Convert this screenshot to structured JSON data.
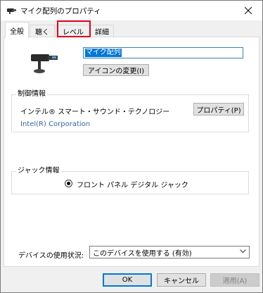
{
  "window": {
    "title": "マイク配列のプロパティ"
  },
  "tabs": [
    {
      "label": "全般",
      "selected": true
    },
    {
      "label": "聴く",
      "selected": false
    },
    {
      "label": "レベル",
      "selected": false,
      "highlighted": true
    },
    {
      "label": "詳細",
      "selected": false
    }
  ],
  "general": {
    "device_name": "マイク配列",
    "change_icon_label": "アイコンの変更(I)",
    "controller_group_label": "制御情報",
    "controller_name": "インテル® スマート・サウンド・テクノロジー",
    "properties_button_label": "プロパティ(P)",
    "manufacturer": "Intel(R) Corporation",
    "jack_group_label": "ジャック情報",
    "jack_description": "フロント パネル デジタル ジャック",
    "usage_label": "デバイスの使用状況:",
    "usage_selected": "このデバイスを使用する (有効)"
  },
  "footer": {
    "ok_label": "OK",
    "cancel_label": "キャンセル",
    "apply_label": "適用(A)"
  },
  "colors": {
    "highlight_box": "#e0001b",
    "selection": "#0078d7",
    "link": "#3a66a8"
  }
}
